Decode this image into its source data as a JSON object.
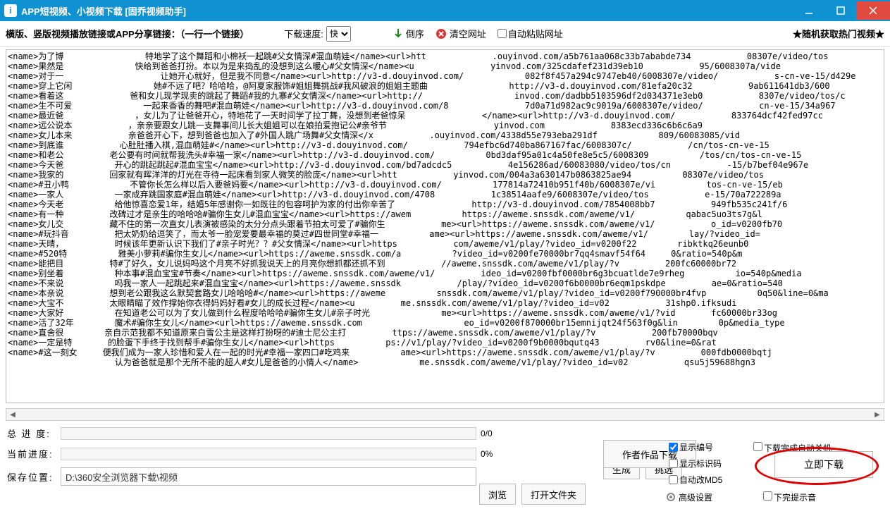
{
  "title": "APP短视频、小视频下载 [固乔视频助手]",
  "toolbar": {
    "link_label": "横版、竖版视频播放链接或APP分享链接：（一行一个链接）",
    "speed_label": "下载速度:",
    "speed_value": "快",
    "reverse": "倒序",
    "clear": "清空网址",
    "auto_paste": "自动粘贴网址",
    "random_hot": "★随机获取热门视频★"
  },
  "url_text": "<name>为了博                特地学了这个舞蹈和小棉袄一起跳#父女情深#混血萌娃</name><url>htt             .ouyinvod.com/a5b761aa068c33b7ababde734           08307e/video/tos\n<name>果然是              快给到爸爸打扮。本以为是来捣乱的没想到这么暖心#父女情深</name><u               yinvod.com/325cdafef231d39eb10           95/6008307a/vide\n<name>对于一                   让她开心就好，但是我不同意</name><url>http://v3-d.douyinvod.com/            082f8f457a294c9747eb40/6008307e/video/           s-cn-ve-15/d429e\n<name>穿上它闲                她#不远了吧？哈哈哈，@阿夏家服饰#姐姐舞挑战#我风破浪的姐姐主题曲                http://v3-d.douyinvod.com/81efa20c32           9ab611641db3/600\n<name>看着这             爸和女儿现学现卖的跳起了舞蹈#我的九寨#父女情深</name><url>http://                  invod.com/dadbb5103596df2d034371e3eb0           8307e/video/tos/c\n<name>生不可爱              一起来香香的舞吧#混血萌娃</name><url>http://v3-d.douyinvod.com/8               7d0a71d982ac9c9019a/6008307e/video/           cn-ve-15/34a967\n<name>最近爸              ，女儿为了让爸爸开心，特地花了一天时间学了拉丁舞，没想到老爸惊呆               </name><url>http://v3-d.douyinvod.com/           833764dcf42fed97cc\n<name>远公说本           ，亲亲要跟女儿跳一支舞事间儿长大姐姐可以在娘拍爱抱记公#亲爷节                     yinvod.com             8383ecd336c6b6c6a9\n<name>女儿本来           亲爸爸开心下，想到爸爸也加入了#外国人跳广场舞#父女情深</x           .ouyinvod.com/4338d55e793eba291df            809/60083085/vid\n<name>到底谁           心肚肚播入棋,混血萌娃#</name><url>http://v3-d.douyinvod.com/           794efbc6d740ba867167fac/6008307c/           /cn/tos-cn-ve-15\n<name>和老公         老公要有时间就帮我洗头#幸福一家</name><url>http://v3-d.douyinvod.com/          0bd3daf95a01c4a50fe8e5c5/6008309          /tos/cn/tos-cn-ve-15\n<name>今天爸          开心的跳起跳起#混血宝宝</name><url>http://v3-d.douyinvod.com/bd7adcdc5           4e156286ad/60083080/video/tos/cn           -15/b7bef04e967e\n<name>我家的         回家就有晖洋洋的灯光在寺待一起床看到家人微笑的脸庞</name><url>htt           yinvod.com/004a3a630147b0863825ae94          08307e/video/tos\n<name>#丑小鸭            不管你长怎么样以后入要爸妈要</name><url>http://v3-d.douyinvod.com/          177814a72410b951f40b/6008307e/vi          tos-cn-ve-15/eb\n<name>一家人          一家成弃跳国家庭#混血萌娃</name><url>http://v3-d.douyinvod.com/4708           1c38514aafe9/6008307e/video/tos           e-15/70a722289a\n<name>今天老          给他惊喜恋爱1年，结婚5年感谢你一如既往的包容呵护为家的付出你辛苦了               http://v3-d.douyinvod.com/7854008bb7           949fb535c241f/6\n<name>有一种         改碑过才是亲生的哈哈哈#骗你生女儿#混血宝宝</name><url>https://awem          https://aweme.snssdk.com/aweme/v1/          qabac5uo3ts7g&l\n<name>女儿交         藏不住的第一次直女儿表演被感染的太分分点头跟着节拍太可爱了#骗你生           me><url>https://aweme.snssdk.com/aweme/v1/           o_id=v0200fb70\n<name>#玩抖音         把太奶奶给逗笑了，而太爷一脸宠爱要最幸福的莫过#四世同堂#幸福一          ame><url>https://aweme.snssdk.com/aweme/v1/        lay/?video_id=\n<name>天晴，          时候该年更新认识下我们了#亲子时光？？#父女情深</name><url>https           com/aweme/v1/play/?video_id=v0200f22        ribktkq26eunb0\n<name>#520特          雅美小萝莉#骗你生女儿</name><url>https://aweme.snssdk.com/a          ?video_id=v0200fe70000br7qq4smavf54f64     0&ratio=540p&m\n<name>能把目         特#了好久，女儿说妈吗这个月亮不好抓我说天上的月亮你想抓都还抓不到           //aweme.snssdk.com/aweme/v1/play/?v         200fc60000br72\n<name>别坐着          种本事#混血宝宝#节奏</name><url>https://aweme.snssdk.com/aweme/v1/         ideo_id=v0200fbf0000br6g3bcuatlde7e9rheg          io=540p&media\n<name>不来说          吗我一家人一起跳起来#混血宝宝</name><url>https://aweme.snssdk           /play/?video_id=v0200f6b0000br6eqm1pskdpe         ae=0&ratio=540\n<name>本亲说         想到老公跟我这么默契套路女儿哈哈哈#</name><url>https://aweme          snssdk.com/aweme/v1/play/?video_id=v0200f790000br4fvp          0q50&line=0&ma\n<name>大宝不         太眼睛瞄了效作撑始你衣得妈妈好看#女儿的成长过程</name><u         me.snssdk.com/aweme/v1/play/?video_id=v02           31shp0.ifksudi\n<name>大家好          在知道老公可以为了女儿做到什么程度哈哈哈#骗你生女儿#亲子时光              me><url>https://aweme.snssdk.com/aweme/v1/?vid       fc60000br33og\n<name>活了32年        魔术#骗你生女儿</name><url>https://aweme.snssdk.com                    eo_id=v0200f870000br15emnijqt24f563f0g&lin        0p&media_type\n<name>直舍很        亲自示范我都不知道原来白雪公主是这样打扮呀的#迪士尼公主打         ttps://aweme.snssdk.com/aweme/v1/play/?v           200fb70000bqv\n<name>一定是特       的脸蛋下手终于找到帮手#骗你生女儿</name><url>https          ps://v1/play/?video_id=v0200f9b0000bqutq43         rv0&line=0&rat\n<name>#这一刻女     便我们成为一家人珍惜和爱人在一起的时光#幸福一家四口#吃鸡来          ame><url>https://aweme.snssdk.com/aweme/v1/play/?v         000fdb0000bqtj\n                     认为爸爸就是那个无所不能的超人#女儿是爸爸的小情人</name>            me.snssdk.com/aweme/v1/play/?video_id=v02           qsu5j59688hgn3",
  "progress": {
    "total_label": "总 进 度:",
    "total_value": "0/0",
    "current_label": "当前进度:",
    "current_value": "0%"
  },
  "save": {
    "label": "保存位置:",
    "path": "D:\\360安全浏览器下载\\视频"
  },
  "buttons": {
    "browse": "浏览",
    "open_folder": "打开文件夹",
    "generate": "生成",
    "filter": "挑选",
    "author_works": "作者作品下载",
    "download_now": "立即下载"
  },
  "options": {
    "show_number": "显示编号",
    "show_code": "显示标识码",
    "auto_md5": "自动改MD5",
    "auto_shutdown": "下载完成自动关机",
    "done_sound": "下完提示音",
    "advanced": "高级设置"
  }
}
